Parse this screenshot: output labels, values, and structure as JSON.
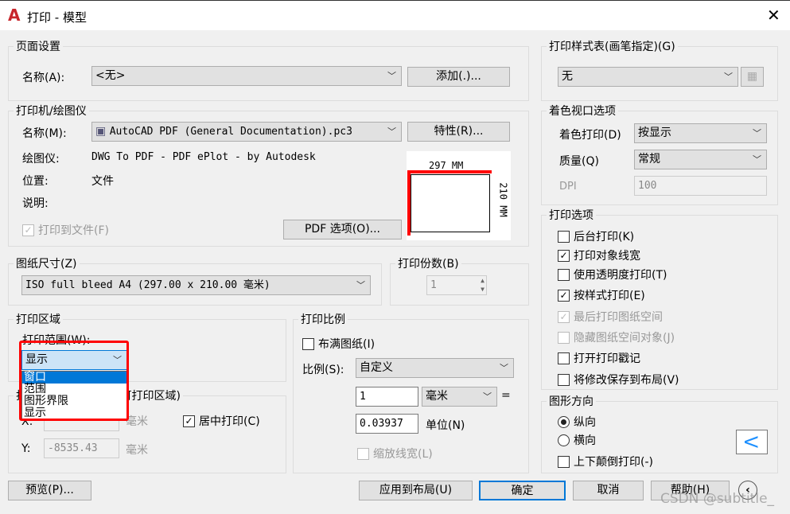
{
  "title": "打印 - 模型",
  "page_setup": {
    "legend": "页面设置",
    "name_label": "名称(A):",
    "name_value": "<无>",
    "add_button": "添加(.)..."
  },
  "plotter": {
    "legend": "打印机/绘图仪",
    "name_label": "名称(M):",
    "name_value": "AutoCAD PDF (General Documentation).pc3",
    "properties_button": "特性(R)...",
    "plotter_label": "绘图仪:",
    "plotter_value": "DWG To PDF - PDF ePlot - by Autodesk",
    "location_label": "位置:",
    "location_value": "文件",
    "description_label": "说明:",
    "plot_to_file": "打印到文件(F)",
    "plot_to_file_checked": true,
    "pdf_options_button": "PDF 选项(O)...",
    "preview_width": "297 MM",
    "preview_height": "210 MM"
  },
  "paper_size": {
    "legend": "图纸尺寸(Z)",
    "value": "ISO full bleed A4 (297.00 x 210.00 毫米)"
  },
  "copies": {
    "legend": "打印份数(B)",
    "value": "1"
  },
  "plot_area": {
    "legend": "打印区域",
    "range_label": "打印范围(W):",
    "selected": "显示",
    "options": [
      "窗口",
      "范围",
      "图形界限",
      "显示"
    ],
    "highlighted": "窗口"
  },
  "offset": {
    "legend": "打印偏移(原点设置在可打印区域)",
    "x_label": "X:",
    "x_value": "",
    "y_label": "Y:",
    "y_value": "-8535.43",
    "unit": "毫米",
    "center": "居中打印(C)",
    "center_checked": true
  },
  "scale": {
    "legend": "打印比例",
    "fit": "布满图纸(I)",
    "fit_checked": false,
    "scale_label": "比例(S):",
    "scale_value": "自定义",
    "value1": "1",
    "unit1": "毫米",
    "equals": "=",
    "value2": "0.03937",
    "unit2": "单位(N)",
    "lineweights": "缩放线宽(L)"
  },
  "style_table": {
    "legend": "打印样式表(画笔指定)(G)",
    "value": "无"
  },
  "shaded": {
    "legend": "着色视口选项",
    "shade_label": "着色打印(D)",
    "shade_value": "按显示",
    "quality_label": "质量(Q)",
    "quality_value": "常规",
    "dpi_label": "DPI",
    "dpi_value": "100"
  },
  "options": {
    "legend": "打印选项",
    "items": [
      {
        "label": "后台打印(K)",
        "checked": false,
        "disabled": false
      },
      {
        "label": "打印对象线宽",
        "checked": true,
        "disabled": false
      },
      {
        "label": "使用透明度打印(T)",
        "checked": false,
        "disabled": false
      },
      {
        "label": "按样式打印(E)",
        "checked": true,
        "disabled": false
      },
      {
        "label": "最后打印图纸空间",
        "checked": true,
        "disabled": true
      },
      {
        "label": "隐藏图纸空间对象(J)",
        "checked": false,
        "disabled": true
      },
      {
        "label": "打开打印戳记",
        "checked": false,
        "disabled": false
      },
      {
        "label": "将修改保存到布局(V)",
        "checked": false,
        "disabled": false
      }
    ]
  },
  "orientation": {
    "legend": "图形方向",
    "portrait": "纵向",
    "landscape": "横向",
    "upside_down": "上下颠倒打印(-)",
    "selected": "纵向"
  },
  "footer": {
    "preview": "预览(P)...",
    "apply": "应用到布局(U)",
    "ok": "确定",
    "cancel": "取消",
    "help": "帮助(H)"
  },
  "watermark": "CSDN @subtitle_",
  "colors": {
    "accent": "#0078d7",
    "highlight_red": "#ff0000",
    "logo_red": "#c8262c"
  }
}
